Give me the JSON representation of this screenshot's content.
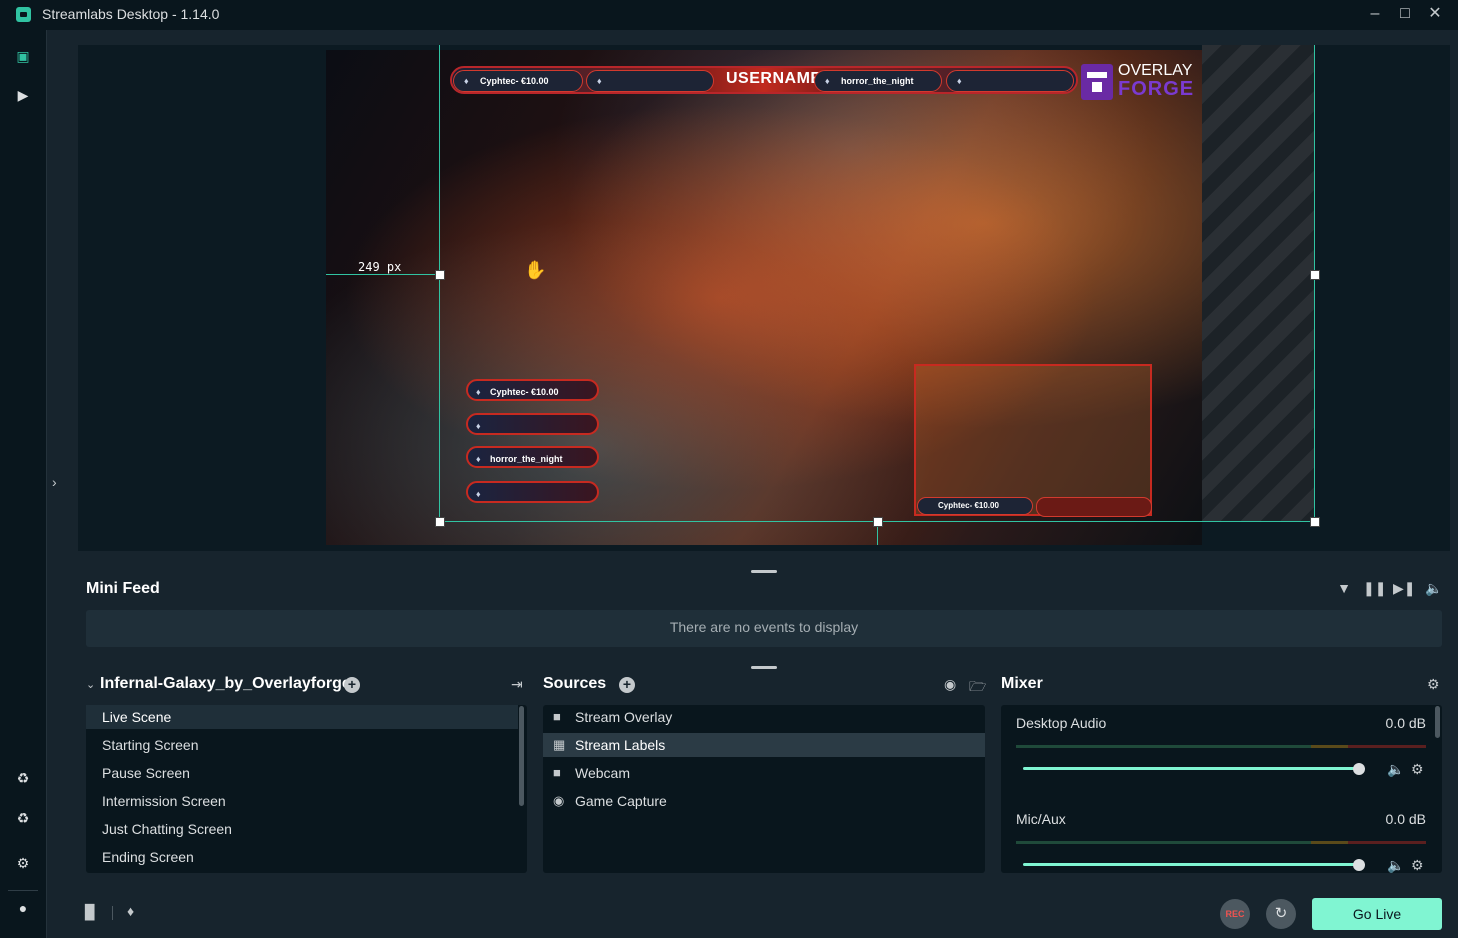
{
  "window": {
    "title": "Streamlabs Desktop - 1.14.0",
    "controls": [
      "minimize",
      "maximize",
      "close"
    ]
  },
  "left_nav": {
    "top_items": [
      {
        "icon": "studio-mode-icon"
      },
      {
        "icon": "play-icon"
      }
    ],
    "bottom_items": [
      {
        "icon": "theme-audit-icon"
      },
      {
        "icon": "app-store-icon"
      },
      {
        "icon": "settings-icon"
      },
      {
        "icon": "user-icon"
      }
    ]
  },
  "preview": {
    "distance_label": "249 px",
    "overlay": {
      "username": "USERNAME",
      "top_labels": [
        "Cyphtec- €10.00",
        "",
        "horror_the_night",
        ""
      ],
      "side_labels": [
        "Cyphtec- €10.00",
        "",
        "horror_the_night",
        ""
      ],
      "cam_label": "Cyphtec- €10.00",
      "logo_line1": "OVERLAY",
      "logo_line2": "FORGE"
    }
  },
  "mini_feed": {
    "title": "Mini Feed",
    "empty_text": "There are no events to display",
    "icons": [
      "filter-icon",
      "pause-icon",
      "skip-icon",
      "volume-icon"
    ]
  },
  "scenes": {
    "collection_name": "Infernal-Galaxy_by_Overlayforge",
    "items": [
      {
        "label": "Live Scene",
        "selected": true
      },
      {
        "label": "Starting Screen",
        "selected": false
      },
      {
        "label": "Pause Screen",
        "selected": false
      },
      {
        "label": "Intermission Screen",
        "selected": false
      },
      {
        "label": "Just Chatting Screen",
        "selected": false
      },
      {
        "label": "Ending Screen",
        "selected": false
      }
    ]
  },
  "sources": {
    "title": "Sources",
    "items": [
      {
        "label": "Stream Overlay",
        "icon": "folder-icon",
        "selected": false
      },
      {
        "label": "Stream Labels",
        "icon": "image-icon",
        "selected": true
      },
      {
        "label": "Webcam",
        "icon": "folder-icon",
        "selected": false
      },
      {
        "label": "Game Capture",
        "icon": "gamepad-icon",
        "selected": false
      }
    ]
  },
  "mixer": {
    "title": "Mixer",
    "channels": [
      {
        "name": "Desktop Audio",
        "db": "0.0 dB",
        "volume": 1.0
      },
      {
        "name": "Mic/Aux",
        "db": "0.0 dB",
        "volume": 1.0
      }
    ]
  },
  "footer": {
    "rec_label": "REC",
    "go_live_label": "Go Live",
    "icons": [
      "stats-icon",
      "notifications-icon",
      "replay-buffer-icon"
    ]
  },
  "colors": {
    "accent": "#80f5d2",
    "selection": "#31c3a2",
    "background": "#17242d",
    "panel": "#09161d",
    "overlay_red": "#c72a20"
  }
}
